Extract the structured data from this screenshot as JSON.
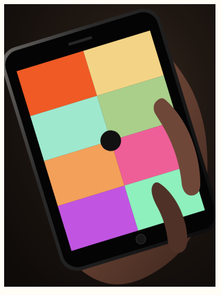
{
  "scene": {
    "colors": {
      "background": "#1a130f",
      "phone_body": "#050505",
      "phone_edge": "#5d5a56",
      "hand_dark": "#3b2319",
      "hand_mid": "#6a4536",
      "hand_light": "#8a5c49",
      "center_dot": "#111111"
    }
  },
  "screen": {
    "tiles": [
      {
        "name": "orange-red",
        "color": "#ef5a25"
      },
      {
        "name": "pale-yellow",
        "color": "#f3d486"
      },
      {
        "name": "mint",
        "color": "#9ee8ce"
      },
      {
        "name": "sage-green",
        "color": "#a9cf8b"
      },
      {
        "name": "orange",
        "color": "#f3a05a"
      },
      {
        "name": "pink",
        "color": "#ee5f98"
      },
      {
        "name": "purple",
        "color": "#c155e1"
      },
      {
        "name": "seafoam",
        "color": "#8ef0bd"
      }
    ]
  }
}
